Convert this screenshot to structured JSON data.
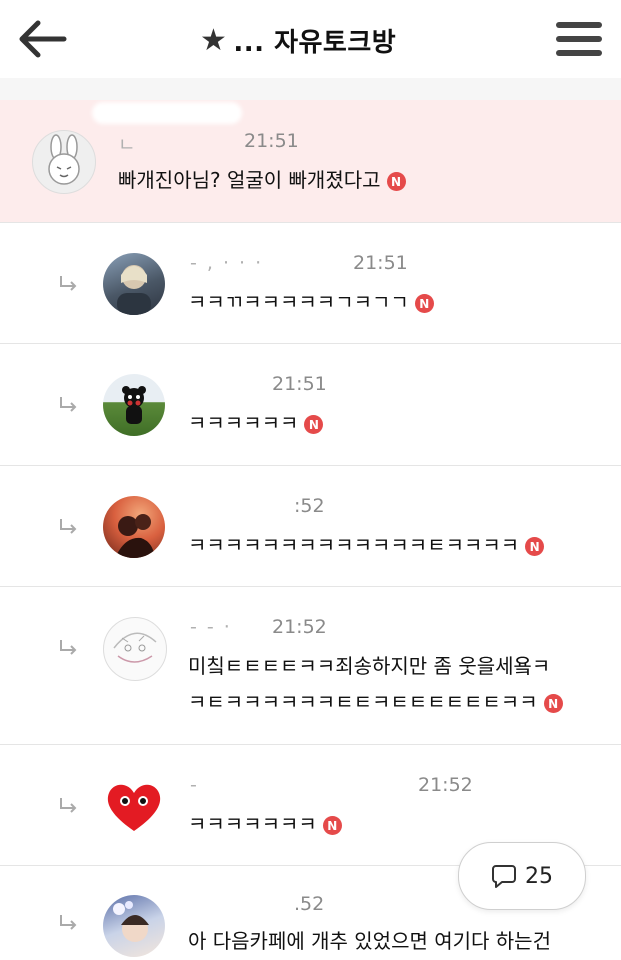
{
  "header": {
    "title_prefix": "★",
    "title": "... 자유토크방"
  },
  "comments": [
    {
      "name": "ㄴ",
      "time": "21:51",
      "text": "빠개진아님? 얼굴이 빠개졌다고",
      "badge": "N",
      "reply": false
    },
    {
      "name": "- , · · ·",
      "time": "21:51",
      "text": "ㅋㅋㄲㅋㅋㅋㅋㅋㄱㅋㄱㄱ",
      "badge": "N",
      "reply": true
    },
    {
      "name": "",
      "time": "21:51",
      "text": "ㅋㅋㅋㅋㅋㅋ",
      "badge": "N",
      "reply": true
    },
    {
      "name": "",
      "time": ":52",
      "text": "ㅋㅋㅋㅋㅋㅋㅋㅋㅋㅋㅋㅋㅋㅌㅋㅋㅋㅋ",
      "badge": "N",
      "reply": true
    },
    {
      "name": "- - ·",
      "time": "21:52",
      "text": "미칰ㅌㅌㅌㅌㅋㅋ죄송하지만 좀 웃을세욬ㅋ",
      "text2": "ㅋㅌㅋㅋㅋㅋㅋㅋㅌㅌㅋㅌㅌㅌㅌㅌㅌㅋㅋ",
      "badge": "N",
      "reply": true
    },
    {
      "name": "-",
      "time": "21:52",
      "text": "ㅋㅋㅋㅋㅋㅋㅋ",
      "badge": "N",
      "reply": true
    },
    {
      "name": "",
      "time": ".52",
      "text": "아 다음카페에 개추 있었으면 여기다 하는건",
      "reply": true
    }
  ],
  "comment_count": "25",
  "icons": {
    "back": "arrow-left-icon",
    "menu": "hamburger-menu-icon",
    "reply": "reply-arrow-icon",
    "comment": "speech-bubble-icon",
    "new": "new-badge-icon"
  },
  "colors": {
    "highlight": "#fdecec",
    "badge": "#e54a4a"
  }
}
